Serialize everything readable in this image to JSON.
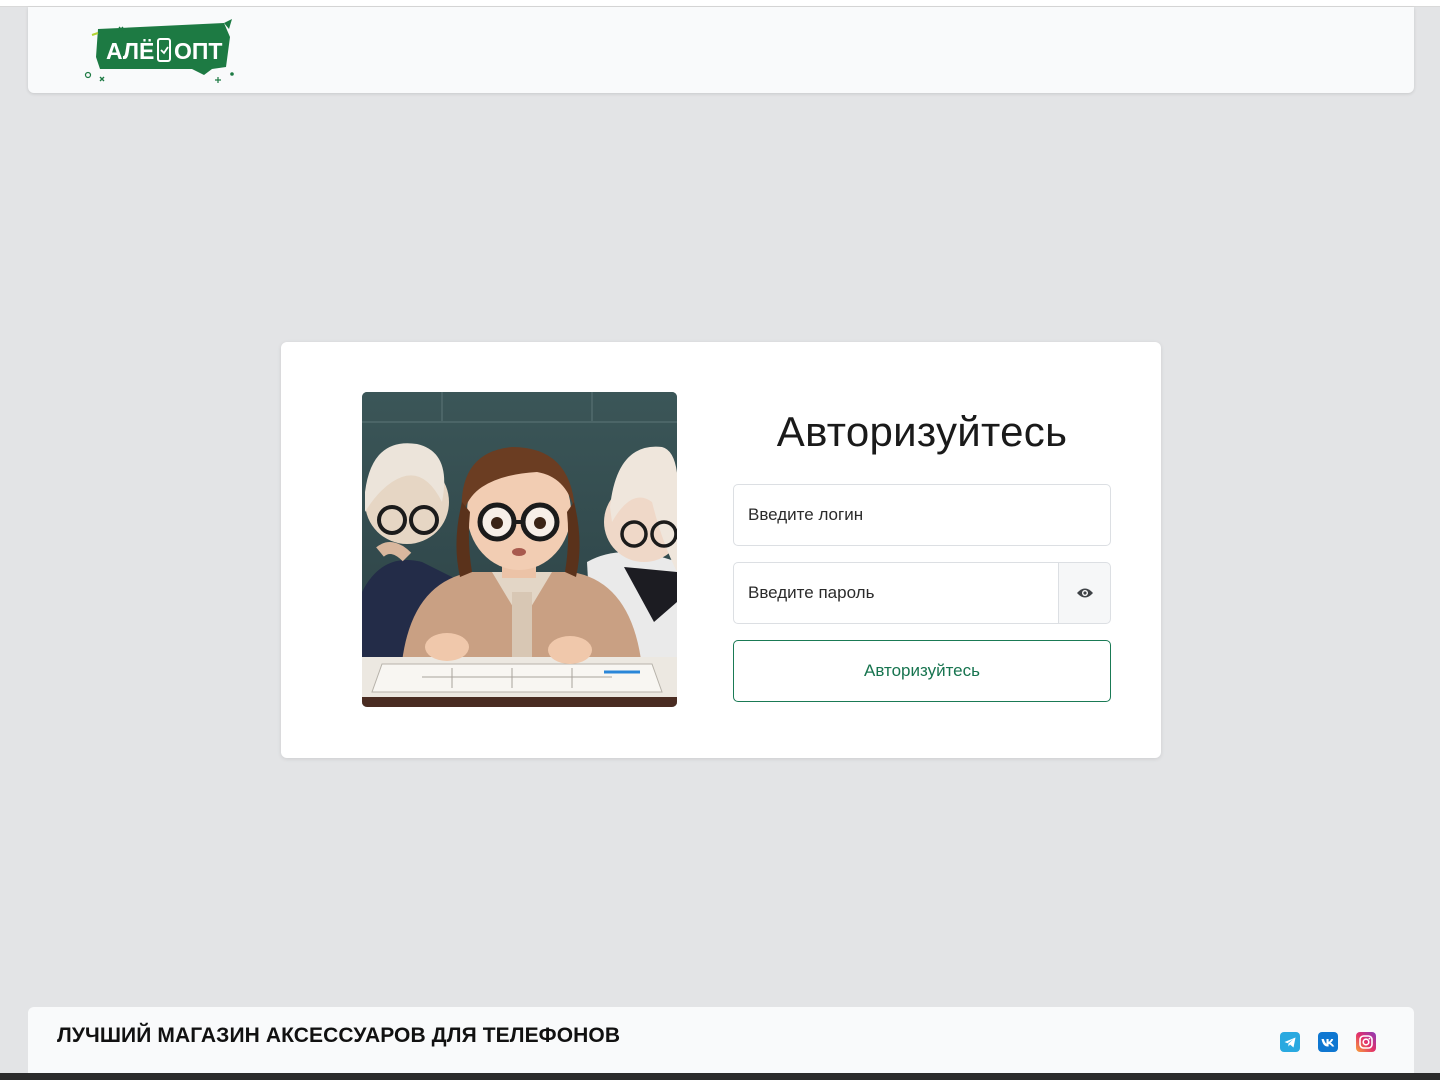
{
  "header": {
    "logo_text": "АЛЁ ОПТ",
    "logo_color": "#1d7a43"
  },
  "login_card": {
    "illustration": "three-students-with-glasses-looking-at-paper",
    "title": "Авторизуйтесь",
    "login_placeholder": "Введите логин",
    "password_placeholder": "Введите пароль",
    "toggle_password_icon": "eye-icon",
    "submit_label": "Авторизуйтесь",
    "accent_color": "#17744f"
  },
  "footer": {
    "tagline": "ЛУЧШИЙ МАГАЗИН АКСЕССУАРОВ ДЛЯ ТЕЛЕФОНОВ",
    "socials": [
      {
        "name": "telegram-icon",
        "color": "#29a9e0"
      },
      {
        "name": "vk-icon",
        "color": "#0f77d1"
      },
      {
        "name": "instagram-icon",
        "color": "#e1306c"
      }
    ]
  }
}
